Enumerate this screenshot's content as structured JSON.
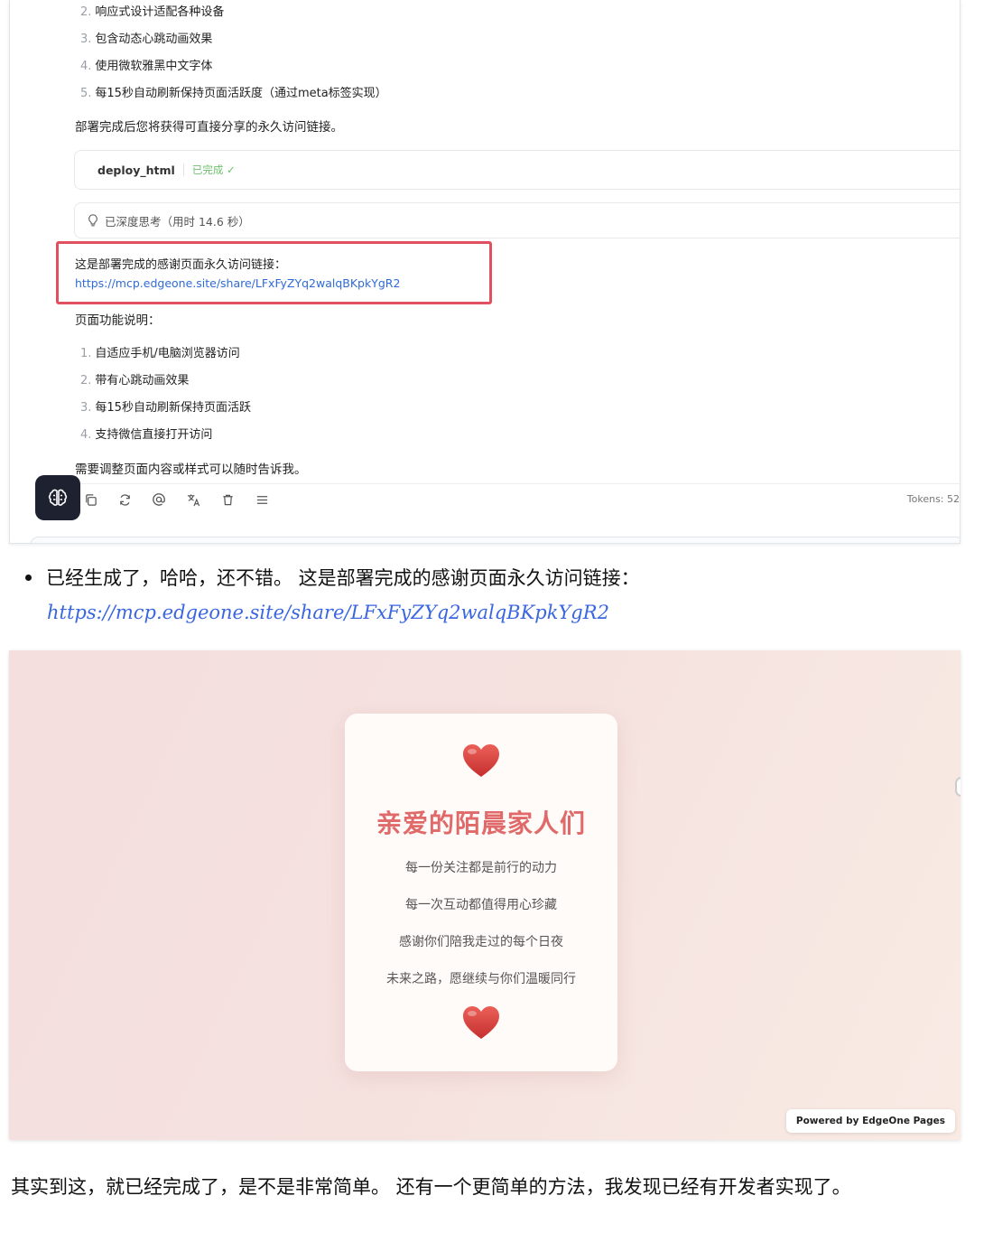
{
  "chat": {
    "list_a": [
      {
        "num": "2.",
        "text": "响应式设计适配各种设备"
      },
      {
        "num": "3.",
        "text": "包含动态心跳动画效果"
      },
      {
        "num": "4.",
        "text": "使用微软雅黑中文字体"
      },
      {
        "num": "5.",
        "text": "每15秒自动刷新保持页面活跃度（通过meta标签实现）"
      }
    ],
    "deploy_note": "部署完成后您将获得可直接分享的永久访问链接。",
    "tool": {
      "name": "deploy_html",
      "status": "已完成 ✓"
    },
    "thinking": "已深度思考（用时 14.6 秒）",
    "link_intro": "这是部署完成的感谢页面永久访问链接：",
    "link_url": "https://mcp.edgeone.site/share/LFxFyZYq2walqBKpkYgR2",
    "features_title": "页面功能说明：",
    "list_b": [
      {
        "num": "1.",
        "text": "自适应手机/电脑浏览器访问"
      },
      {
        "num": "2.",
        "text": "带有心跳动画效果"
      },
      {
        "num": "3.",
        "text": "每15秒自动刷新保持页面活跃"
      },
      {
        "num": "4.",
        "text": "支持微信直接打开访问"
      }
    ],
    "closing_note": "需要调整页面内容或样式可以随时告诉我。",
    "tokens": "Tokens: 52",
    "toolbar_icons": [
      "copy-icon",
      "refresh-icon",
      "mention-icon",
      "translate-icon",
      "delete-icon",
      "menu-icon"
    ]
  },
  "article": {
    "bullet_text": "已经生成了，哈哈，还不错。 这是部署完成的感谢页面永久访问链接：",
    "link": "https://mcp.edgeone.site/share/LFxFyZYq2walqBKpkYgR2",
    "closing": "其实到这，就已经完成了，是不是非常简单。 还有一个更简单的方法，我发现已经有开发者实现了。"
  },
  "thanks_page": {
    "title": "亲爱的陌晨家人们",
    "lines": [
      "每一份关注都是前行的动力",
      "每一次互动都值得用心珍藏",
      "感谢你们陪我走过的每个日夜",
      "未来之路，愿继续与你们温暖同行"
    ],
    "powered_by": "Powered by EdgeOne Pages",
    "heart_color": "#d8403f",
    "title_color": "#e06a6a"
  }
}
